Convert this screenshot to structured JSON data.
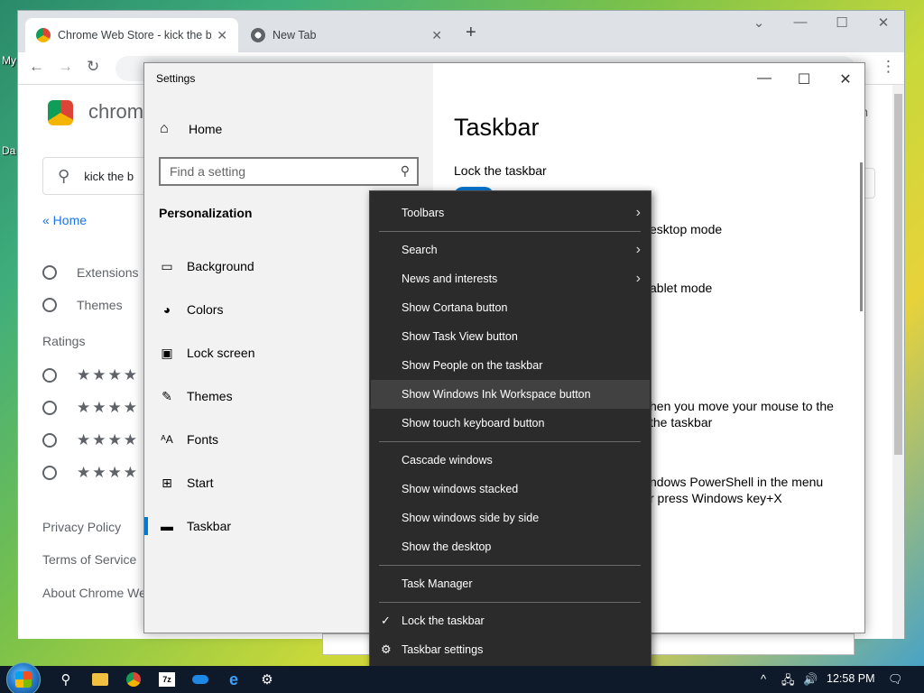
{
  "desktop": {
    "label_1": "My",
    "label_2": "Da"
  },
  "chrome": {
    "tabs": [
      {
        "title": "Chrome Web Store - kick the bu",
        "close": "✕"
      },
      {
        "title": "New Tab",
        "close": "✕"
      }
    ],
    "new_tab": "+",
    "controls": {
      "dropdown": "⌄",
      "minimize": "—",
      "maximize": "☐",
      "close": "✕"
    },
    "toolbar": {
      "back": "←",
      "forward": "→",
      "reload": "↻",
      "menu": "⋮"
    }
  },
  "store": {
    "logo_text": "chrom",
    "right_text": "in",
    "search_value": "kick the b",
    "home_link": "« Home",
    "categories": [
      {
        "label": "Extensions"
      },
      {
        "label": "Themes"
      }
    ],
    "ratings_title": "Ratings",
    "ratings": [
      {
        "stars": "★★★★",
        "rating": 4
      },
      {
        "stars": "★★★★",
        "rating": 4
      },
      {
        "stars": "★★★★",
        "rating": 3
      },
      {
        "stars": "★★★★",
        "rating": 2
      }
    ],
    "footer": [
      "Privacy Policy",
      "Terms of Service",
      "About Chrome We"
    ]
  },
  "settings": {
    "window_title": "Settings",
    "home": "Home",
    "search_placeholder": "Find a setting",
    "section": "Personalization",
    "nav": [
      {
        "label": "Background",
        "icon": "image-icon"
      },
      {
        "label": "Colors",
        "icon": "palette-icon"
      },
      {
        "label": "Lock screen",
        "icon": "lock-screen-icon"
      },
      {
        "label": "Themes",
        "icon": "themes-icon"
      },
      {
        "label": "Fonts",
        "icon": "fonts-icon"
      },
      {
        "label": "Start",
        "icon": "start-icon"
      },
      {
        "label": "Taskbar",
        "icon": "taskbar-icon",
        "selected": true
      }
    ],
    "controls": {
      "minimize": "—",
      "maximize": "☐",
      "close": "✕"
    },
    "content": {
      "title": "Taskbar",
      "lock_label": "Lock the taskbar",
      "partial_1": "esktop mode",
      "partial_2": "ablet mode",
      "partial_3": "hen you move your mouse to the",
      "partial_4": "the taskbar",
      "partial_5": "ndows PowerShell in the menu",
      "partial_6": "r press Windows key+X"
    }
  },
  "context_menu": {
    "items": [
      {
        "label": "Toolbars",
        "submenu": true
      },
      {
        "label": "Search",
        "submenu": true
      },
      {
        "label": "News and interests",
        "submenu": true
      },
      {
        "label": "Show Cortana button"
      },
      {
        "label": "Show Task View button"
      },
      {
        "label": "Show People on the taskbar"
      },
      {
        "label": "Show Windows Ink Workspace button",
        "hover": true
      },
      {
        "label": "Show touch keyboard button"
      },
      {
        "label": "Cascade windows"
      },
      {
        "label": "Show windows stacked"
      },
      {
        "label": "Show windows side by side"
      },
      {
        "label": "Show the desktop"
      },
      {
        "label": "Task Manager"
      },
      {
        "label": "Lock the taskbar",
        "checked": true
      },
      {
        "label": "Taskbar settings",
        "gear": true
      }
    ],
    "arrow": "›",
    "check": "✓",
    "gear": "⚙"
  },
  "taskbar": {
    "clock": "12:58 PM",
    "tray_chevron": "^",
    "volume": "🔊",
    "notifications": "🗨"
  },
  "colors": {
    "accent": "#0078d4",
    "menu_bg": "#2b2b2b",
    "menu_hover": "#414141"
  }
}
